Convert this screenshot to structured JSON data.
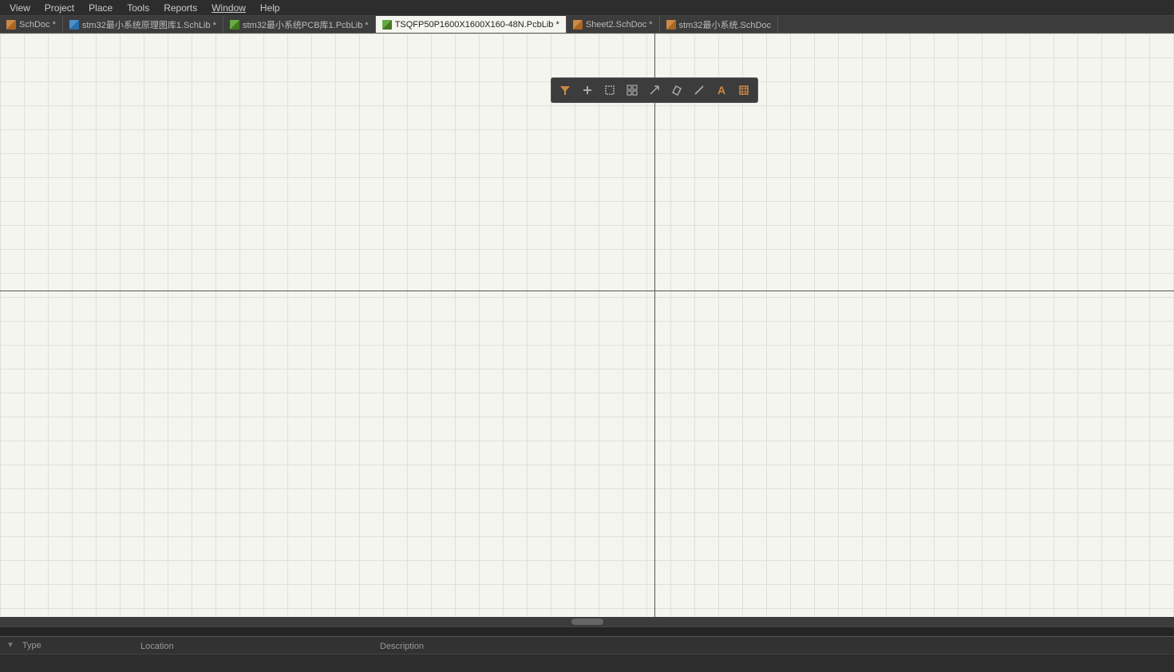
{
  "menubar": {
    "items": [
      {
        "id": "view",
        "label": "View",
        "underlined": false
      },
      {
        "id": "project",
        "label": "Project",
        "underlined": false
      },
      {
        "id": "place",
        "label": "Place",
        "underlined": false
      },
      {
        "id": "tools",
        "label": "Tools",
        "underlined": false
      },
      {
        "id": "reports",
        "label": "Reports",
        "underlined": false
      },
      {
        "id": "window",
        "label": "Window",
        "underlined": true
      },
      {
        "id": "help",
        "label": "Help",
        "underlined": false
      }
    ]
  },
  "tabs": [
    {
      "id": "schdoc-prev",
      "label": "SchDoc *",
      "icon": "schdoc",
      "active": false
    },
    {
      "id": "schlib1",
      "label": "stm32最小系统原理图库1.SchLib *",
      "icon": "schlib",
      "active": false
    },
    {
      "id": "pcblib1",
      "label": "stm32最小系统PCB库1.PcbLib *",
      "icon": "pcblib",
      "active": false
    },
    {
      "id": "pcbdoc",
      "label": "TSQFP50P1600X1600X160-48N.PcbLib *",
      "icon": "pcblib",
      "active": true
    },
    {
      "id": "sheet2",
      "label": "Sheet2.SchDoc *",
      "icon": "schdoc",
      "active": false
    },
    {
      "id": "schdoc-main",
      "label": "stm32最小系统.SchDoc",
      "icon": "schdoc",
      "active": false
    }
  ],
  "toolbar": {
    "buttons": [
      {
        "id": "filter",
        "icon": "filter",
        "symbol": "▼",
        "tooltip": "Filter"
      },
      {
        "id": "add",
        "icon": "add",
        "symbol": "+",
        "tooltip": "Add"
      },
      {
        "id": "rect-select",
        "icon": "rect-select",
        "symbol": "⬜",
        "tooltip": "Rectangle Select"
      },
      {
        "id": "grid",
        "icon": "grid",
        "symbol": "⊞",
        "tooltip": "Grid"
      },
      {
        "id": "snap",
        "icon": "snap",
        "symbol": "⤢",
        "tooltip": "Snap"
      },
      {
        "id": "eraser",
        "icon": "eraser",
        "symbol": "◇",
        "tooltip": "Eraser"
      },
      {
        "id": "line",
        "icon": "line",
        "symbol": "╱",
        "tooltip": "Line"
      },
      {
        "id": "text",
        "icon": "text",
        "symbol": "A",
        "tooltip": "Text"
      },
      {
        "id": "component",
        "icon": "component",
        "symbol": "▣",
        "tooltip": "Component"
      }
    ]
  },
  "canvas": {
    "background": "#f5f5f0",
    "gridColor": "#e0e0da",
    "crosshairColor": "#555555"
  },
  "bottomPanel": {
    "columns": [
      {
        "id": "type",
        "label": "Type",
        "sortable": true
      },
      {
        "id": "location",
        "label": "Location",
        "sortable": false
      },
      {
        "id": "description",
        "label": "Description",
        "sortable": false
      }
    ]
  },
  "colors": {
    "menuBg": "#2d2d2d",
    "tabBg": "#3c3c3c",
    "activeTab": "#f5f5f0",
    "canvasBg": "#f5f5f0",
    "toolbarBg": "#3c3c3c"
  }
}
